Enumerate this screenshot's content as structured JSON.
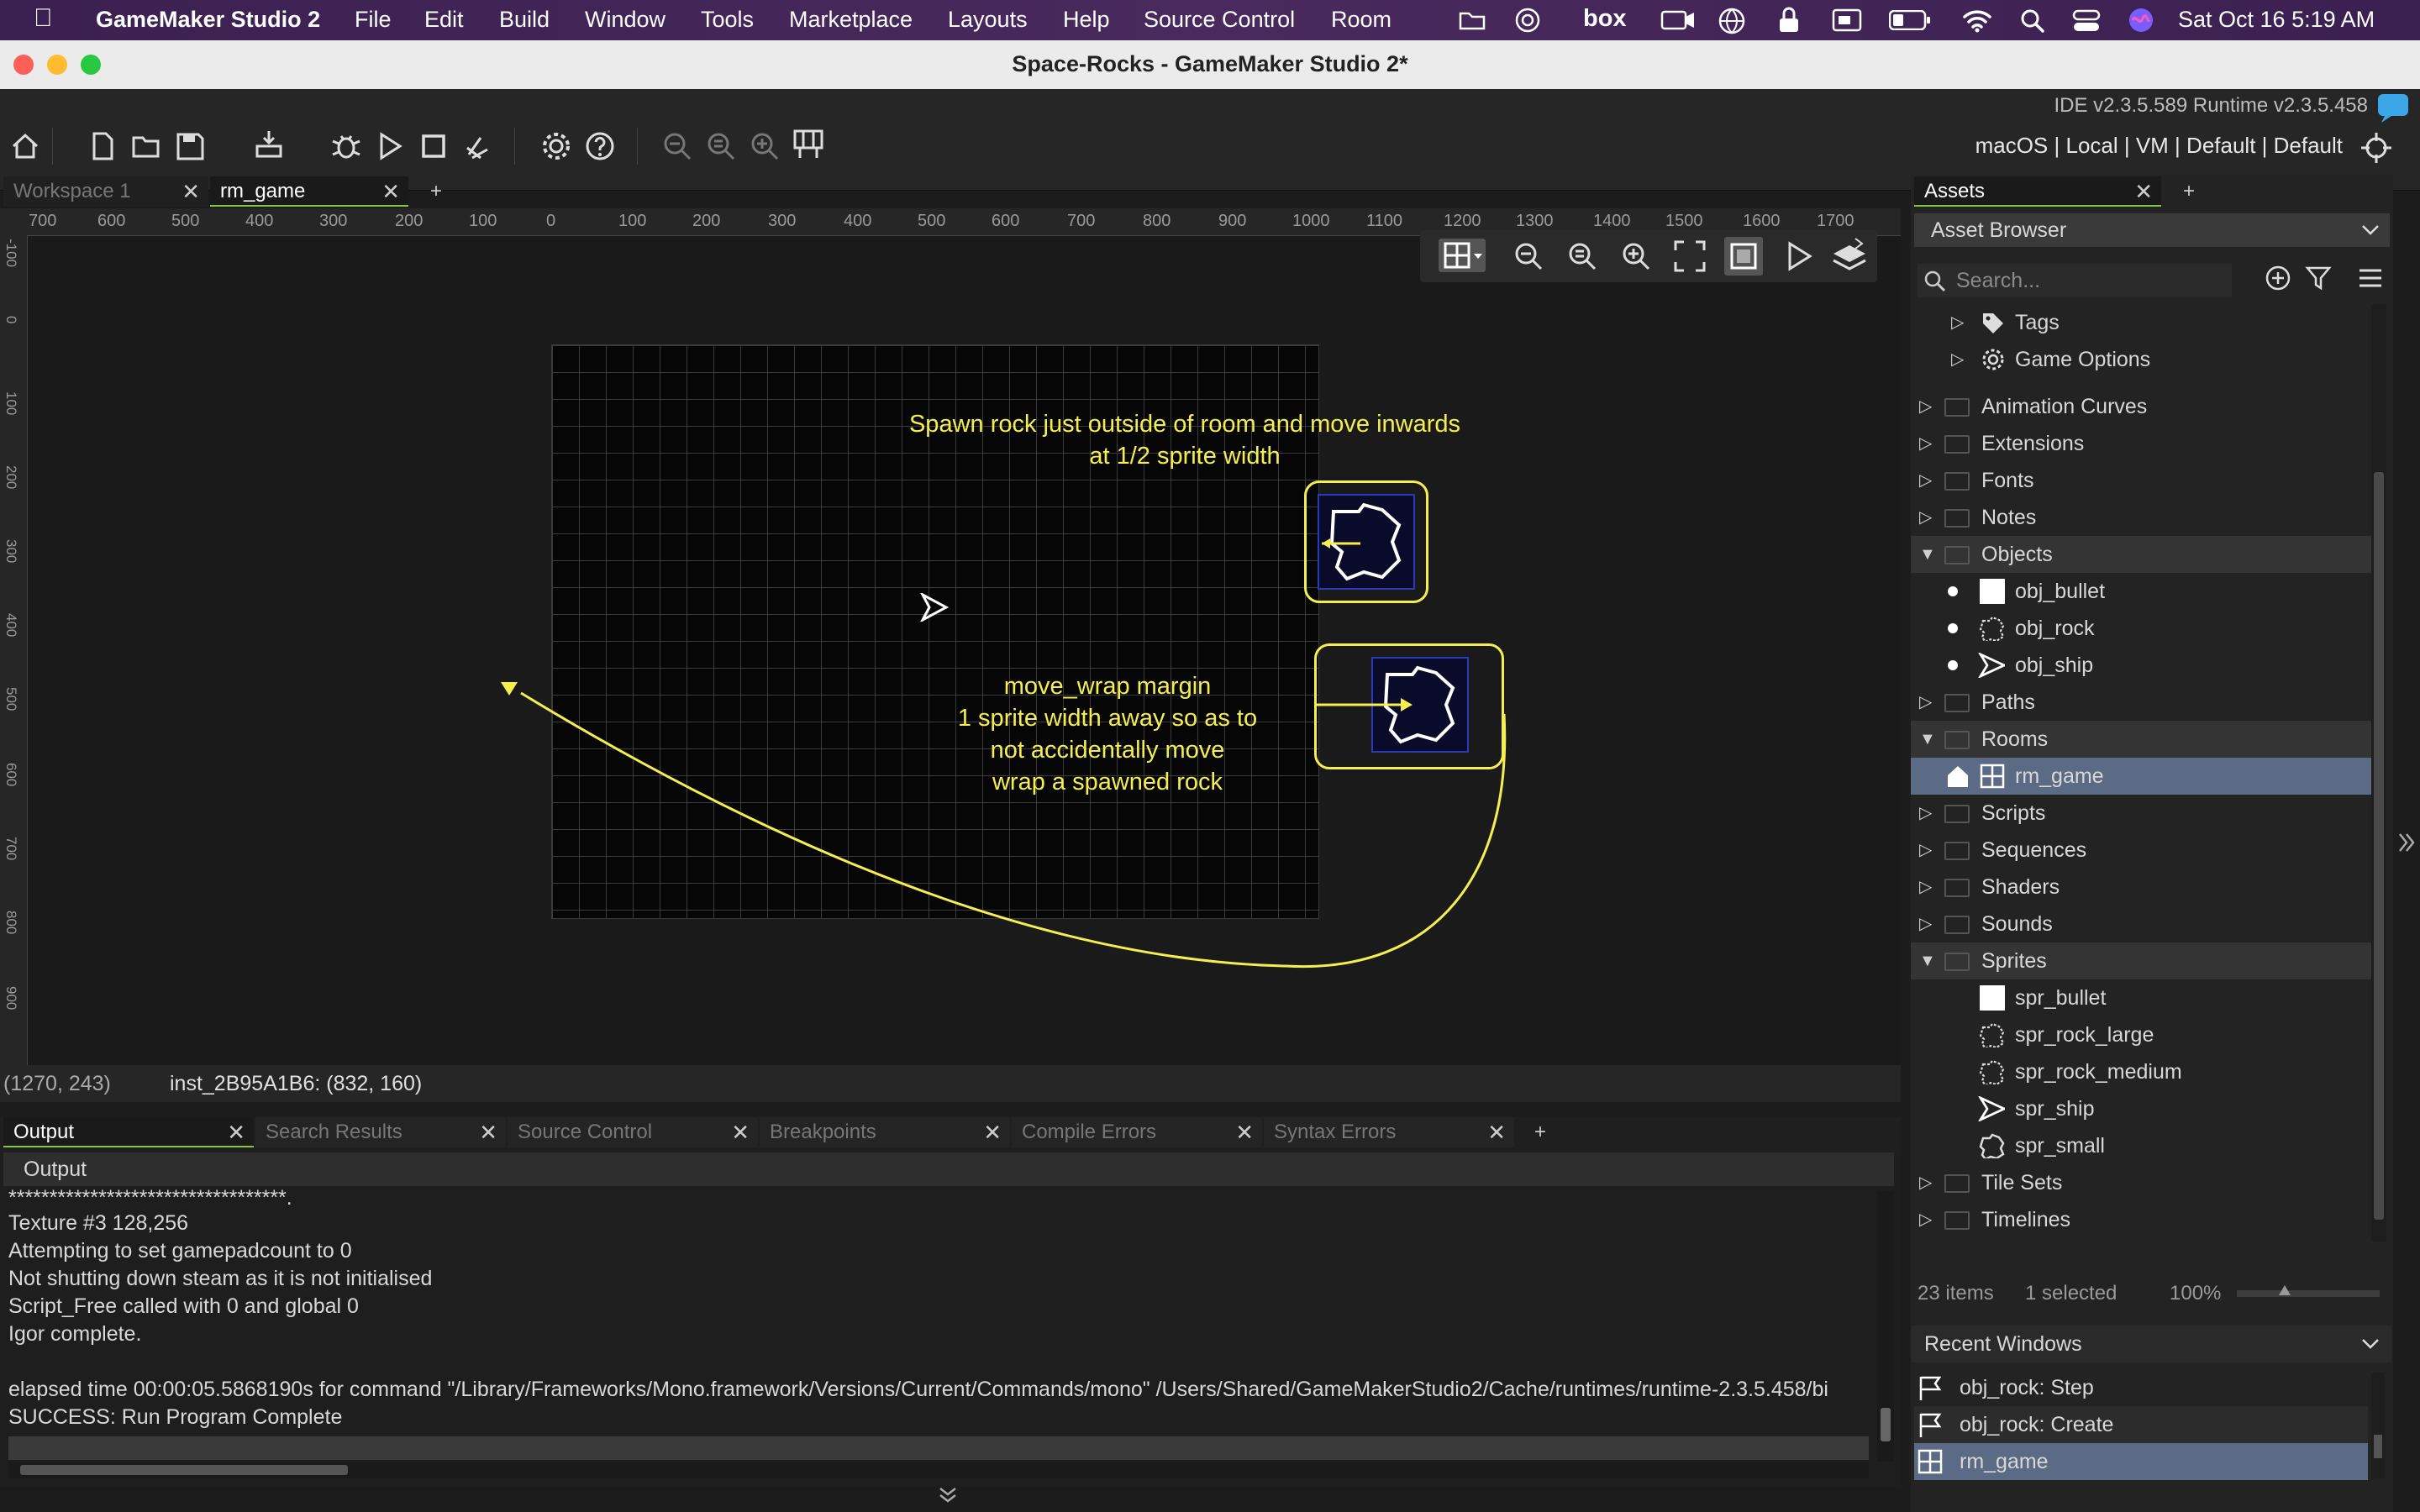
{
  "menubar": {
    "app_name": "GameMaker Studio 2",
    "items": [
      "File",
      "Edit",
      "Build",
      "Window",
      "Tools",
      "Marketplace",
      "Layouts",
      "Help",
      "Source Control",
      "Room"
    ],
    "status_box": "box",
    "clock": "Sat Oct 16  5:19 AM"
  },
  "window": {
    "title": "Space-Rocks - GameMaker Studio 2*"
  },
  "toolbar": {
    "version": "IDE v2.3.5.589  Runtime v2.3.5.458",
    "target": "macOS | Local | VM | Default | Default"
  },
  "doc_tabs": {
    "workspace": "Workspace 1",
    "room": "rm_game",
    "add": "+",
    "close": "✕"
  },
  "ruler": {
    "top": [
      "700",
      "600",
      "500",
      "400",
      "300",
      "200",
      "100",
      "0",
      "100",
      "200",
      "300",
      "400",
      "500",
      "600",
      "700",
      "800",
      "900",
      "1000",
      "1100",
      "1200",
      "1300",
      "1400",
      "1500",
      "1600",
      "1700"
    ],
    "left": [
      "-100",
      "0",
      "100",
      "200",
      "300",
      "400",
      "500",
      "600",
      "700",
      "800",
      "900"
    ]
  },
  "room": {
    "note_spawn_line1": "Spawn rock just outside of room and move inwards",
    "note_spawn_line2": "at 1/2 sprite width",
    "note_wrap_line1": "move_wrap margin",
    "note_wrap_line2": "1 sprite width away so as to",
    "note_wrap_line3": "not accidentally move",
    "note_wrap_line4": "wrap a spawned rock"
  },
  "status": {
    "cursor": "(1270, 243)",
    "instance": "inst_2B95A1B6: (832, 160)"
  },
  "output_tabs": [
    "Output",
    "Search Results",
    "Source Control",
    "Breakpoints",
    "Compile Errors",
    "Syntax Errors"
  ],
  "output": {
    "header": "Output",
    "lines": [
      "**********************************.",
      "Texture #3 128,256",
      "Attempting to set gamepadcount to 0",
      "Not shutting down steam as it is not initialised",
      "Script_Free called with 0 and global 0",
      "Igor complete.",
      "",
      "elapsed time 00:00:05.5868190s for command \"/Library/Frameworks/Mono.framework/Versions/Current/Commands/mono\" /Users/Shared/GameMakerStudio2/Cache/runtimes/runtime-2.3.5.458/bi",
      "SUCCESS: Run Program Complete"
    ]
  },
  "assets": {
    "tab": "Assets",
    "browser_title": "Asset Browser",
    "search_placeholder": "Search...",
    "tags": "Tags",
    "game_options": "Game Options",
    "groups": {
      "animation_curves": "Animation Curves",
      "extensions": "Extensions",
      "fonts": "Fonts",
      "notes": "Notes",
      "objects": "Objects",
      "paths": "Paths",
      "rooms": "Rooms",
      "scripts": "Scripts",
      "sequences": "Sequences",
      "shaders": "Shaders",
      "sounds": "Sounds",
      "sprites": "Sprites",
      "tile_sets": "Tile Sets",
      "timelines": "Timelines"
    },
    "objects": [
      "obj_bullet",
      "obj_rock",
      "obj_ship"
    ],
    "rooms": [
      "rm_game"
    ],
    "sprites": [
      "spr_bullet",
      "spr_rock_large",
      "spr_rock_medium",
      "spr_ship",
      "spr_small"
    ],
    "footer_count": "23 items",
    "footer_selected": "1 selected",
    "footer_zoom": "100%"
  },
  "recent": {
    "title": "Recent Windows",
    "items": [
      "obj_rock: Step",
      "obj_rock: Create",
      "rm_game"
    ]
  },
  "colors": {
    "accent_yellow": "#f4ef4f",
    "selection": "#5b6b85"
  }
}
